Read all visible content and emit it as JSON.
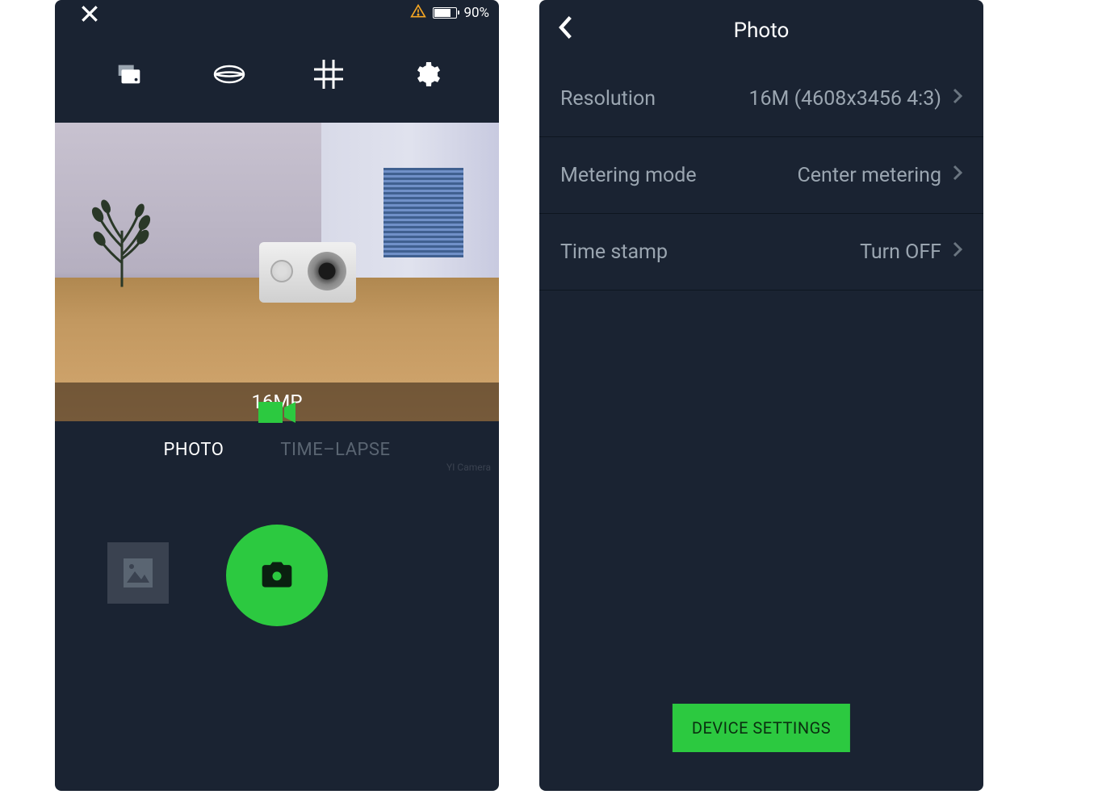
{
  "left": {
    "battery_pct": "90%",
    "resolution_overlay": "16MP",
    "tabs": {
      "photo": "PHOTO",
      "timelapse": "TIME–LAPSE"
    },
    "watermark": "YI Camera"
  },
  "right": {
    "title": "Photo",
    "rows": [
      {
        "label": "Resolution",
        "value": "16M (4608x3456 4:3)"
      },
      {
        "label": "Metering mode",
        "value": "Center metering"
      },
      {
        "label": "Time stamp",
        "value": "Turn OFF"
      }
    ],
    "device_settings": "DEVICE SETTINGS"
  }
}
